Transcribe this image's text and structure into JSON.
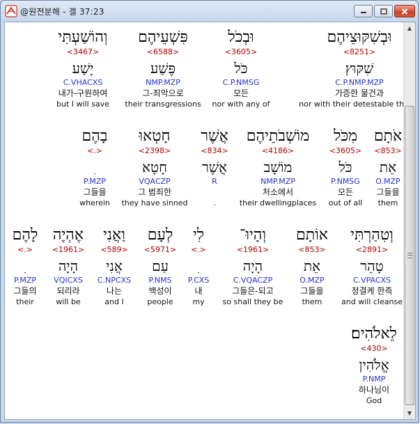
{
  "window": {
    "title": "@원전분해 - 겔 37:23"
  },
  "rows": [
    {
      "words": [
        {
          "heb": "וּבְשִׁקּוּצֵיהֶם",
          "strong": "<8251>",
          "lemma": "שִׁקּוּץ",
          "morph": "C.P.NMP.MZP",
          "kor": "가증한 물건과",
          "eng": "nor with their detestable things"
        },
        {
          "heb": "וּבְכֹל",
          "strong": "<3605>",
          "lemma": "כֹּל",
          "morph": "C.P.NMSG",
          "kor": "모든",
          "eng": "nor with any of"
        },
        {
          "heb": "פִּשְׁעֵיהֶם",
          "strong": "<6588>",
          "lemma": "פֶּשַׁע",
          "morph": "NMP.MZP",
          "kor": "그-죄악으로",
          "eng": "their transgressions"
        },
        {
          "heb": "וְהוֹשַׁעְתִּי",
          "strong": "<3467>",
          "lemma": "יָשַׁע",
          "morph": "C.VHACXS",
          "kor": "내가-구원하여",
          "eng": "but I will save"
        }
      ]
    },
    {
      "words": [
        {
          "heb": "אֹתָם",
          "strong": "<853>",
          "lemma": "אֵת",
          "morph": "O.MZP",
          "kor": "그들을",
          "eng": "them"
        },
        {
          "heb": "מִכֹּל",
          "strong": "<3605>",
          "lemma": "כֹּל",
          "morph": "P.NMSG",
          "kor": "모든",
          "eng": "out of all"
        },
        {
          "heb": "מוֹשְׁבֹתֵיהֶם",
          "strong": "<4186>",
          "lemma": "מוֹשָׁב",
          "morph": "NMP.MZP",
          "kor": "처소에서",
          "eng": "their dwellingplaces"
        },
        {
          "heb": "אֲשֶׁר",
          "strong": "<834>",
          "lemma": "אֲשֶׁר",
          "morph": "R",
          "kor": "",
          "eng": "."
        },
        {
          "heb": "חָטְאוּ",
          "strong": "<2398>",
          "lemma": "חָטָא",
          "morph": "VQACZP",
          "kor": "그 범죄한",
          "eng": "they have sinned"
        },
        {
          "heb": "בָהֶם",
          "strong": "<.>",
          "lemma": "ִ",
          "morph": "P.MZP",
          "kor": "그들을",
          "eng": "wherein"
        }
      ]
    },
    {
      "words": [
        {
          "heb": "וְטִהַרְתִּי",
          "strong": "<2891>",
          "lemma": "טָהֵר",
          "morph": "C.VPACXS",
          "kor": "정결케 한즉",
          "eng": "and will cleanse"
        },
        {
          "heb": "אוֹתָם",
          "strong": "<853>",
          "lemma": "אֵת",
          "morph": "O.MZP",
          "kor": "그들을",
          "eng": "them"
        },
        {
          "heb": "וְהָיוּ־",
          "strong": "<1961>",
          "lemma": "הָיָה",
          "morph": "C.VQACZP",
          "kor": "그들은-되고",
          "eng": "so shall they be"
        },
        {
          "heb": "לִי",
          "strong": "<.>",
          "lemma": "ִ",
          "morph": "P.CXS",
          "kor": "내",
          "eng": "my"
        },
        {
          "heb": "לְעָם",
          "strong": "<5971>",
          "lemma": "עַם",
          "morph": "P.NMS",
          "kor": "백성이",
          "eng": "people"
        },
        {
          "heb": "וַאֲנִי",
          "strong": "<589>",
          "lemma": "אֲנִי",
          "morph": "C.NPCXS",
          "kor": "나는",
          "eng": "and I"
        },
        {
          "heb": "אֶהְיֶה",
          "strong": "<1961>",
          "lemma": "הָיָה",
          "morph": "VQICXS",
          "kor": "되리라",
          "eng": "will be"
        },
        {
          "heb": "לָהֶם",
          "strong": "<.>",
          "lemma": "ִ",
          "morph": "P.MZP",
          "kor": "그들의",
          "eng": "their"
        }
      ]
    },
    {
      "words": [
        {
          "heb": "לֵאלֹהִים׃",
          "strong": "<430>",
          "lemma": "אֱלֹהִין",
          "morph": "P.NMP",
          "kor": "하나님이",
          "eng": "God"
        }
      ]
    }
  ]
}
